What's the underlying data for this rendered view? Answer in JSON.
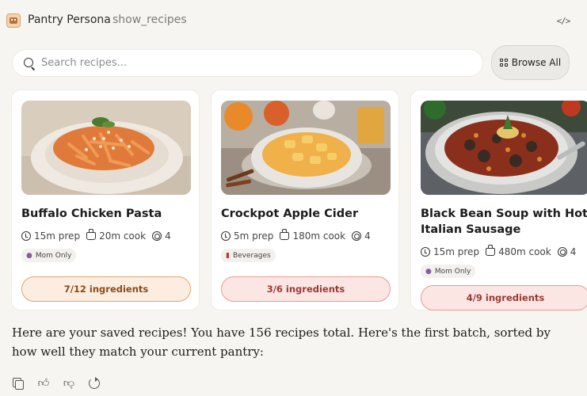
{
  "header": {
    "app_name": "Pantry Persona",
    "tool_name": "show_recipes",
    "code_label": "</>"
  },
  "search": {
    "placeholder": "Search recipes...",
    "value": ""
  },
  "browse_all_label": "Browse All",
  "recipes": [
    {
      "title": "Buffalo Chicken Pasta",
      "prep": "15m prep",
      "cook": "20m cook",
      "servings": "4",
      "tag": "Mom Only",
      "tag_icon": "person-icon",
      "ingredients": "7/12 ingredients",
      "match_color": "#f6ddc4"
    },
    {
      "title": "Crockpot Apple Cider",
      "prep": "5m prep",
      "cook": "180m cook",
      "servings": "4",
      "tag": "Beverages",
      "tag_icon": "cup-icon",
      "ingredients": "3/6 ingredients",
      "match_color": "#f6d2cf"
    },
    {
      "title": "Black Bean Soup with Hot Italian Sausage",
      "prep": "15m prep",
      "cook": "480m cook",
      "servings": "4",
      "tag": "Mom Only",
      "tag_icon": "person-icon",
      "ingredients": "4/9 ingredients",
      "match_color": "#f6d2cf"
    }
  ],
  "message": "Here are your saved recipes! You have 156 recipes total. Here's the first batch, sorted by how well they match your current pantry:",
  "actions": [
    "copy-icon",
    "thumbs-up-icon",
    "thumbs-down-icon",
    "retry-icon"
  ]
}
